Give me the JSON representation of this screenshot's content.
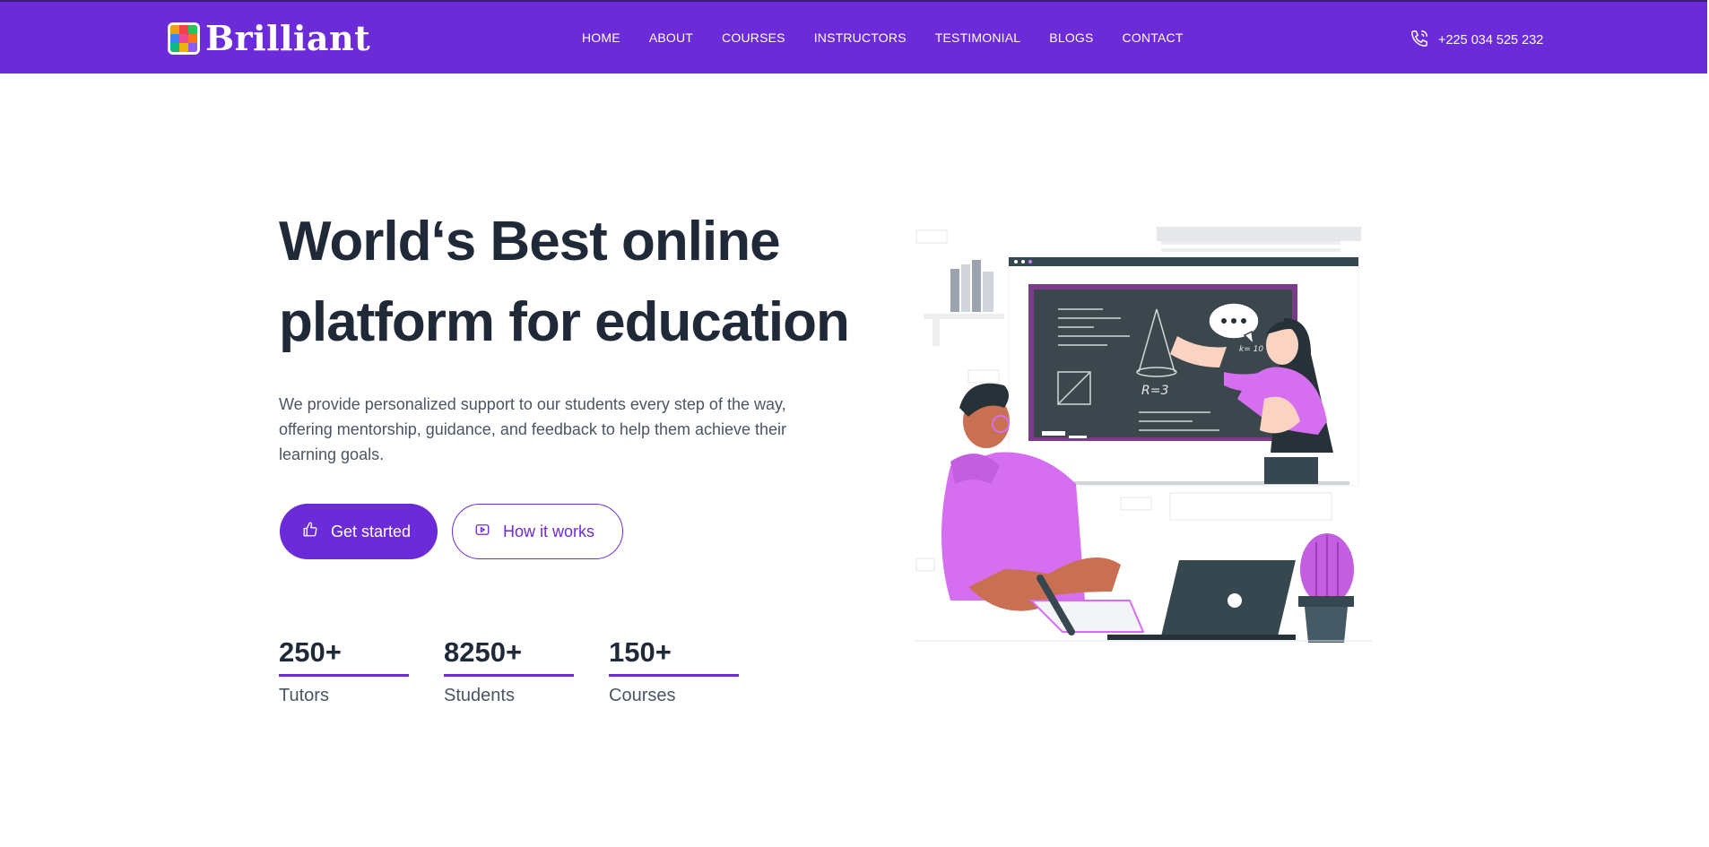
{
  "brand": {
    "name": "Brilliant",
    "accent": "#6c2bd9"
  },
  "nav": {
    "items": [
      {
        "label": "HOME"
      },
      {
        "label": "ABOUT"
      },
      {
        "label": "COURSES"
      },
      {
        "label": "INSTRUCTORS"
      },
      {
        "label": "TESTIMONIAL"
      },
      {
        "label": "BLOGS"
      },
      {
        "label": "CONTACT"
      }
    ],
    "phone": {
      "icon": "phone-icon",
      "number": "+225 034 525 232"
    }
  },
  "hero": {
    "title_line1": "World‘s Best online",
    "title_line2": "platform for education",
    "description": "We provide personalized support to our students every step of the way, offering mentorship, guidance, and feedback to help them achieve their learning goals.",
    "primary_button": {
      "label": "Get started",
      "icon": "thumbs-up-icon"
    },
    "secondary_button": {
      "label": "How it works",
      "icon": "play-icon"
    },
    "stats": [
      {
        "value": "250+",
        "label": "Tutors"
      },
      {
        "value": "8250+",
        "label": "Students"
      },
      {
        "value": "150+",
        "label": "Courses"
      }
    ],
    "illustration": {
      "board_text": "R=3",
      "board_note": "k= 10"
    }
  }
}
